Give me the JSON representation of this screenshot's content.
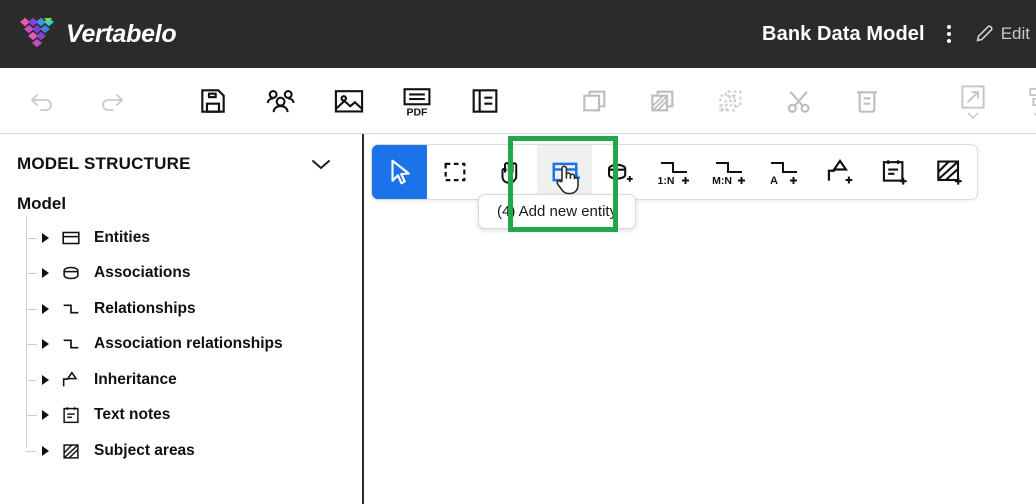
{
  "header": {
    "brand_name": "Vertabelo",
    "logo_icon": "vertabelo-logo-icon",
    "doc_title": "Bank Data Model",
    "kebab_icon": "more-vertical-icon",
    "edit_label": "Edit",
    "edit_icon": "pencil-icon",
    "background_color": "#2b2b2b"
  },
  "toolbar": {
    "groups": [
      {
        "name": "history",
        "buttons": [
          {
            "name": "undo-button",
            "icon": "undo-icon",
            "disabled": true
          },
          {
            "name": "redo-button",
            "icon": "redo-icon",
            "disabled": true
          }
        ]
      },
      {
        "name": "file",
        "buttons": [
          {
            "name": "save-button",
            "icon": "save-floppy-icon",
            "disabled": false
          },
          {
            "name": "share-button",
            "icon": "people-icon",
            "disabled": false
          },
          {
            "name": "export-image-button",
            "icon": "image-icon",
            "disabled": false
          },
          {
            "name": "export-pdf-button",
            "icon": "pdf-icon",
            "disabled": false
          },
          {
            "name": "documentation-button",
            "icon": "book-icon",
            "disabled": false
          }
        ]
      },
      {
        "name": "clipboard",
        "buttons": [
          {
            "name": "copy-button",
            "icon": "copy-icon",
            "disabled": true
          },
          {
            "name": "paste-button",
            "icon": "paste-icon",
            "disabled": true
          },
          {
            "name": "paste-special-button",
            "icon": "paste-special-icon",
            "disabled": true
          },
          {
            "name": "cut-button",
            "icon": "scissors-icon",
            "disabled": true
          },
          {
            "name": "delete-button",
            "icon": "trash-icon",
            "disabled": true
          }
        ]
      },
      {
        "name": "arrange",
        "buttons": [
          {
            "name": "resize-button",
            "icon": "resize-icon",
            "disabled": true,
            "caret": true
          },
          {
            "name": "align-vertical-button",
            "icon": "align-vertical-icon",
            "disabled": true,
            "caret": true
          },
          {
            "name": "distribute-button",
            "icon": "distribute-icon",
            "disabled": true,
            "caret": true
          },
          {
            "name": "layers-button",
            "icon": "layers-icon",
            "disabled": true,
            "caret": true
          },
          {
            "name": "line-routing-button",
            "icon": "line-routing-icon",
            "disabled": true,
            "caret": true
          }
        ]
      }
    ]
  },
  "sidebar": {
    "title": "MODEL STRUCTURE",
    "collapse_icon": "chevron-down-icon",
    "root_label": "Model",
    "items": [
      {
        "label": "Entities",
        "icon": "entity-icon",
        "expand_icon": "triangle-right-icon"
      },
      {
        "label": "Associations",
        "icon": "association-icon",
        "expand_icon": "triangle-right-icon"
      },
      {
        "label": "Relationships",
        "icon": "relationship-icon",
        "expand_icon": "triangle-right-icon"
      },
      {
        "label": "Association relationships",
        "icon": "relationship-icon",
        "expand_icon": "triangle-right-icon"
      },
      {
        "label": "Inheritance",
        "icon": "inheritance-icon",
        "expand_icon": "triangle-right-icon"
      },
      {
        "label": "Text notes",
        "icon": "note-icon",
        "expand_icon": "triangle-right-icon"
      },
      {
        "label": "Subject areas",
        "icon": "subject-area-icon",
        "expand_icon": "triangle-right-icon"
      }
    ]
  },
  "canvas_toolbar": {
    "buttons": [
      {
        "name": "select-tool",
        "icon": "cursor-arrow-icon",
        "state": "active"
      },
      {
        "name": "marquee-select-tool",
        "icon": "dashed-rectangle-icon",
        "state": "normal"
      },
      {
        "name": "pan-tool",
        "icon": "hand-icon",
        "state": "normal"
      },
      {
        "name": "add-entity-tool",
        "icon": "add-entity-icon",
        "state": "hovered"
      },
      {
        "name": "add-association-tool",
        "icon": "add-association-icon",
        "state": "normal"
      },
      {
        "name": "add-one-to-many-tool",
        "icon": "relationship-1n-icon",
        "label": "1:N",
        "state": "normal"
      },
      {
        "name": "add-many-to-many-tool",
        "icon": "relationship-mn-icon",
        "label": "M:N",
        "state": "normal"
      },
      {
        "name": "add-association-relationship-tool",
        "icon": "relationship-a-icon",
        "label": "A",
        "state": "normal"
      },
      {
        "name": "add-inheritance-tool",
        "icon": "add-inheritance-icon",
        "state": "normal"
      },
      {
        "name": "add-text-note-tool",
        "icon": "add-note-icon",
        "state": "normal"
      },
      {
        "name": "add-subject-area-tool",
        "icon": "add-subject-area-icon",
        "state": "normal"
      }
    ],
    "tooltip_text": "(4) Add new entity"
  },
  "highlight": {
    "color": "#22a74a",
    "target": "add-entity-tool"
  },
  "cursor": {
    "type": "pointing-hand-cursor"
  }
}
